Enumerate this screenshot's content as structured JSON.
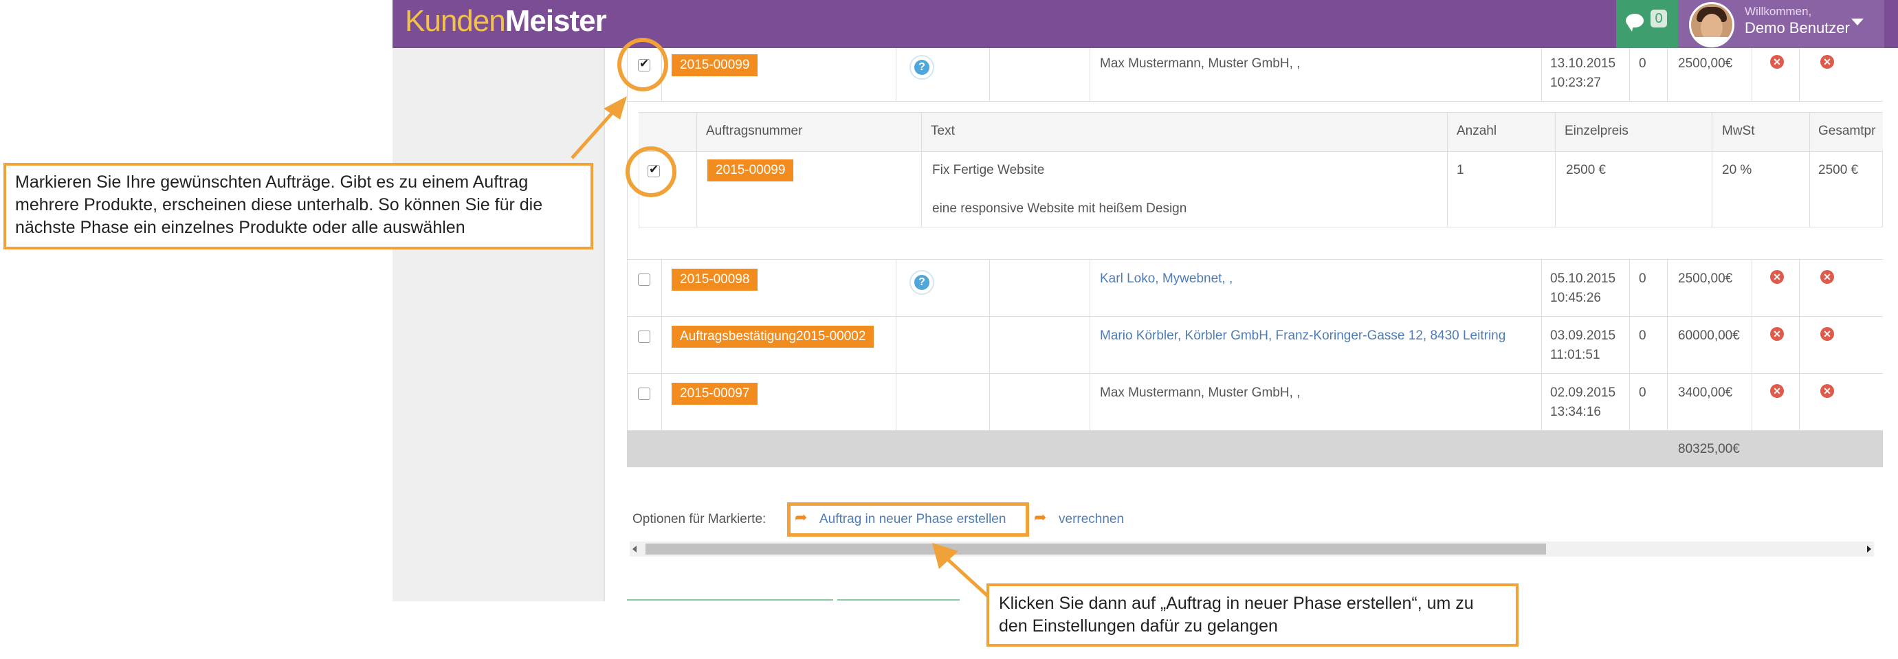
{
  "app": {
    "logo_part1": "Kunden",
    "logo_part2": "Meister"
  },
  "header": {
    "message_count": "0",
    "welcome": "Willkommen,",
    "user_name": "Demo Benutzer"
  },
  "orders": [
    {
      "number": "2015-00099",
      "customer": "Max Mustermann, Muster GmbH, ,",
      "date": "13.10.2015",
      "time": "10:23:27",
      "count": "0",
      "amount": "2500,00€",
      "checked": true,
      "has_help": true
    },
    {
      "number": "2015-00098",
      "customer": "Karl Loko, Mywebnet, ,",
      "date": "05.10.2015",
      "time": "10:45:26",
      "count": "0",
      "amount": "2500,00€",
      "checked": false,
      "has_help": true
    },
    {
      "number": "Auftragsbestätigung2015-00002",
      "customer": "Mario Körbler, Körbler GmbH, Franz-Koringer-Gasse 12, 8430 Leitring",
      "date": "03.09.2015",
      "time": "11:01:51",
      "count": "0",
      "amount": "60000,00€",
      "checked": false,
      "has_help": false
    },
    {
      "number": "2015-00097",
      "customer": "Max Mustermann, Muster GmbH, ,",
      "date": "02.09.2015",
      "time": "13:34:16",
      "count": "0",
      "amount": "3400,00€",
      "checked": false,
      "has_help": false
    }
  ],
  "subtable": {
    "headers": {
      "number": "Auftragsnummer",
      "text": "Text",
      "count": "Anzahl",
      "unit_price": "Einzelpreis",
      "vat": "MwSt",
      "total": "Gesamtpr"
    },
    "row": {
      "number": "2015-00099",
      "title": "Fix Fertige Website",
      "description": "eine responsive Website mit heißem Design",
      "count": "1",
      "unit_price": "2500 €",
      "vat": "20 %",
      "total": "2500 €"
    }
  },
  "sum_total": "80325,00€",
  "options": {
    "label": "Optionen für Markierte:",
    "create_phase": "Auftrag in neuer Phase erstellen",
    "settle": "verrechnen"
  },
  "callouts": {
    "select_orders": "Markieren Sie Ihre gewünschten Aufträge. Gibt es zu einem Auftrag mehrere Produkte, erscheinen diese unterhalb. So können Sie für die nächste Phase ein einzelnes Produkte oder alle auswählen",
    "click_create": "Klicken Sie dann auf „Auftrag in neuer Phase erstellen“, um zu den Einstellungen dafür zu gelangen"
  },
  "colors": {
    "header": "#7a4d94",
    "accent": "#f28c1e",
    "callout_border": "#f0a238",
    "link": "#4f7db3",
    "delete": "#de5b4c"
  },
  "icons": [
    "chat-icon",
    "caret-down-icon",
    "help-icon",
    "delete-icon",
    "share-arrow-icon",
    "scroll-left-icon",
    "scroll-right-icon"
  ]
}
